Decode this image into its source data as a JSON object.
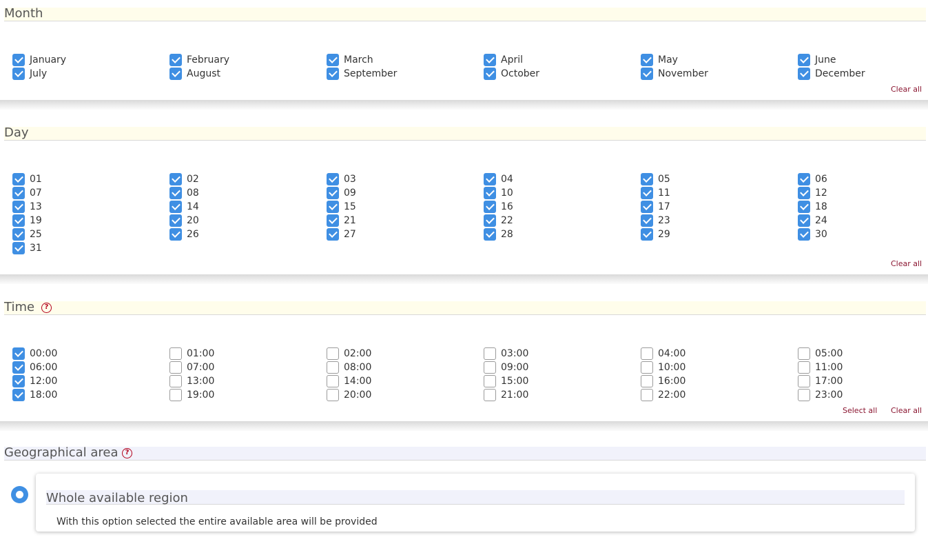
{
  "month": {
    "title": "Month",
    "clear_all": "Clear all",
    "items": [
      {
        "label": "January",
        "checked": true
      },
      {
        "label": "February",
        "checked": true
      },
      {
        "label": "March",
        "checked": true
      },
      {
        "label": "April",
        "checked": true
      },
      {
        "label": "May",
        "checked": true
      },
      {
        "label": "June",
        "checked": true
      },
      {
        "label": "July",
        "checked": true
      },
      {
        "label": "August",
        "checked": true
      },
      {
        "label": "September",
        "checked": true
      },
      {
        "label": "October",
        "checked": true
      },
      {
        "label": "November",
        "checked": true
      },
      {
        "label": "December",
        "checked": true
      }
    ]
  },
  "day": {
    "title": "Day",
    "clear_all": "Clear all",
    "items": [
      {
        "label": "01",
        "checked": true
      },
      {
        "label": "02",
        "checked": true
      },
      {
        "label": "03",
        "checked": true
      },
      {
        "label": "04",
        "checked": true
      },
      {
        "label": "05",
        "checked": true
      },
      {
        "label": "06",
        "checked": true
      },
      {
        "label": "07",
        "checked": true
      },
      {
        "label": "08",
        "checked": true
      },
      {
        "label": "09",
        "checked": true
      },
      {
        "label": "10",
        "checked": true
      },
      {
        "label": "11",
        "checked": true
      },
      {
        "label": "12",
        "checked": true
      },
      {
        "label": "13",
        "checked": true
      },
      {
        "label": "14",
        "checked": true
      },
      {
        "label": "15",
        "checked": true
      },
      {
        "label": "16",
        "checked": true
      },
      {
        "label": "17",
        "checked": true
      },
      {
        "label": "18",
        "checked": true
      },
      {
        "label": "19",
        "checked": true
      },
      {
        "label": "20",
        "checked": true
      },
      {
        "label": "21",
        "checked": true
      },
      {
        "label": "22",
        "checked": true
      },
      {
        "label": "23",
        "checked": true
      },
      {
        "label": "24",
        "checked": true
      },
      {
        "label": "25",
        "checked": true
      },
      {
        "label": "26",
        "checked": true
      },
      {
        "label": "27",
        "checked": true
      },
      {
        "label": "28",
        "checked": true
      },
      {
        "label": "29",
        "checked": true
      },
      {
        "label": "30",
        "checked": true
      },
      {
        "label": "31",
        "checked": true
      }
    ]
  },
  "time": {
    "title": "Time",
    "help_icon": "?",
    "select_all": "Select all",
    "clear_all": "Clear all",
    "items": [
      {
        "label": "00:00",
        "checked": true
      },
      {
        "label": "01:00",
        "checked": false
      },
      {
        "label": "02:00",
        "checked": false
      },
      {
        "label": "03:00",
        "checked": false
      },
      {
        "label": "04:00",
        "checked": false
      },
      {
        "label": "05:00",
        "checked": false
      },
      {
        "label": "06:00",
        "checked": true
      },
      {
        "label": "07:00",
        "checked": false
      },
      {
        "label": "08:00",
        "checked": false
      },
      {
        "label": "09:00",
        "checked": false
      },
      {
        "label": "10:00",
        "checked": false
      },
      {
        "label": "11:00",
        "checked": false
      },
      {
        "label": "12:00",
        "checked": true
      },
      {
        "label": "13:00",
        "checked": false
      },
      {
        "label": "14:00",
        "checked": false
      },
      {
        "label": "15:00",
        "checked": false
      },
      {
        "label": "16:00",
        "checked": false
      },
      {
        "label": "17:00",
        "checked": false
      },
      {
        "label": "18:00",
        "checked": true
      },
      {
        "label": "19:00",
        "checked": false
      },
      {
        "label": "20:00",
        "checked": false
      },
      {
        "label": "21:00",
        "checked": false
      },
      {
        "label": "22:00",
        "checked": false
      },
      {
        "label": "23:00",
        "checked": false
      }
    ]
  },
  "geo": {
    "title": "Geographical area",
    "help_icon": "?",
    "option": {
      "title": "Whole available region",
      "description": "With this option selected the entire available area will be provided",
      "selected": true
    }
  },
  "colors": {
    "accent": "#3f8fe3",
    "link": "#8a1530",
    "help": "#b3001b",
    "header_yellow": "#fffdeb",
    "header_blue": "#f1f2fb"
  }
}
